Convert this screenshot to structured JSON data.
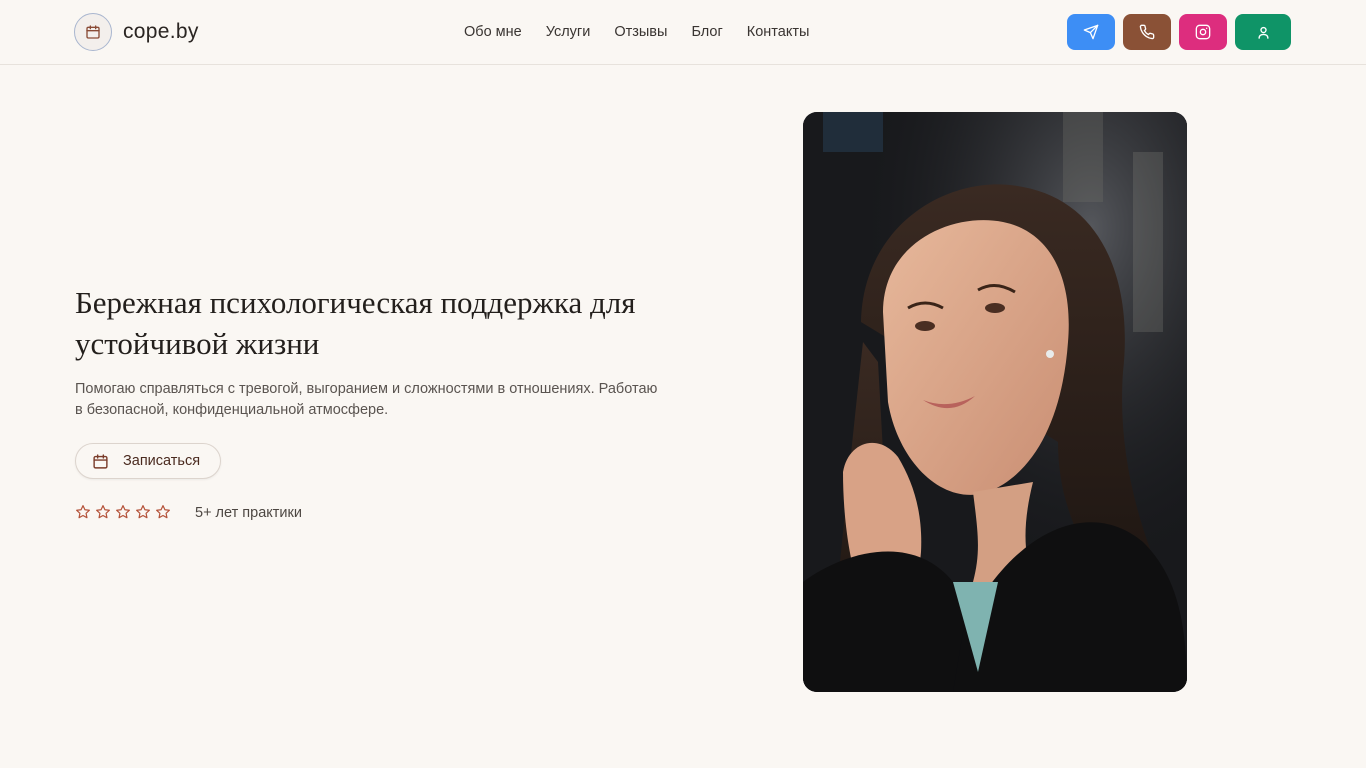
{
  "header": {
    "logo_text": "cope.by",
    "logo_icon": "calendar-icon",
    "nav": [
      {
        "label": "Обо мне"
      },
      {
        "label": "Услуги"
      },
      {
        "label": "Отзывы"
      },
      {
        "label": "Блог"
      },
      {
        "label": "Контакты"
      }
    ],
    "contact_buttons": [
      {
        "icon": "telegram-icon",
        "color": "#3d8ef5"
      },
      {
        "icon": "phone-icon",
        "color": "#8a5136"
      },
      {
        "icon": "instagram-icon",
        "color": "#dd2d7e"
      },
      {
        "icon": "user-icon",
        "color": "#0f9467"
      }
    ]
  },
  "hero": {
    "title": "Бережная психологическая поддержка для устойчивой жизни",
    "subtitle": "Помогаю справляться с тревогой, выгоранием и сложностями в отношениях. Работаю в безопасной, конфиденциальной атмосфере.",
    "cta_label": "Записаться",
    "cta_icon": "calendar-icon",
    "star_count": 5,
    "star_color": "#b4533a",
    "experience": "5+ лет практики",
    "photo": "portrait-photo"
  }
}
